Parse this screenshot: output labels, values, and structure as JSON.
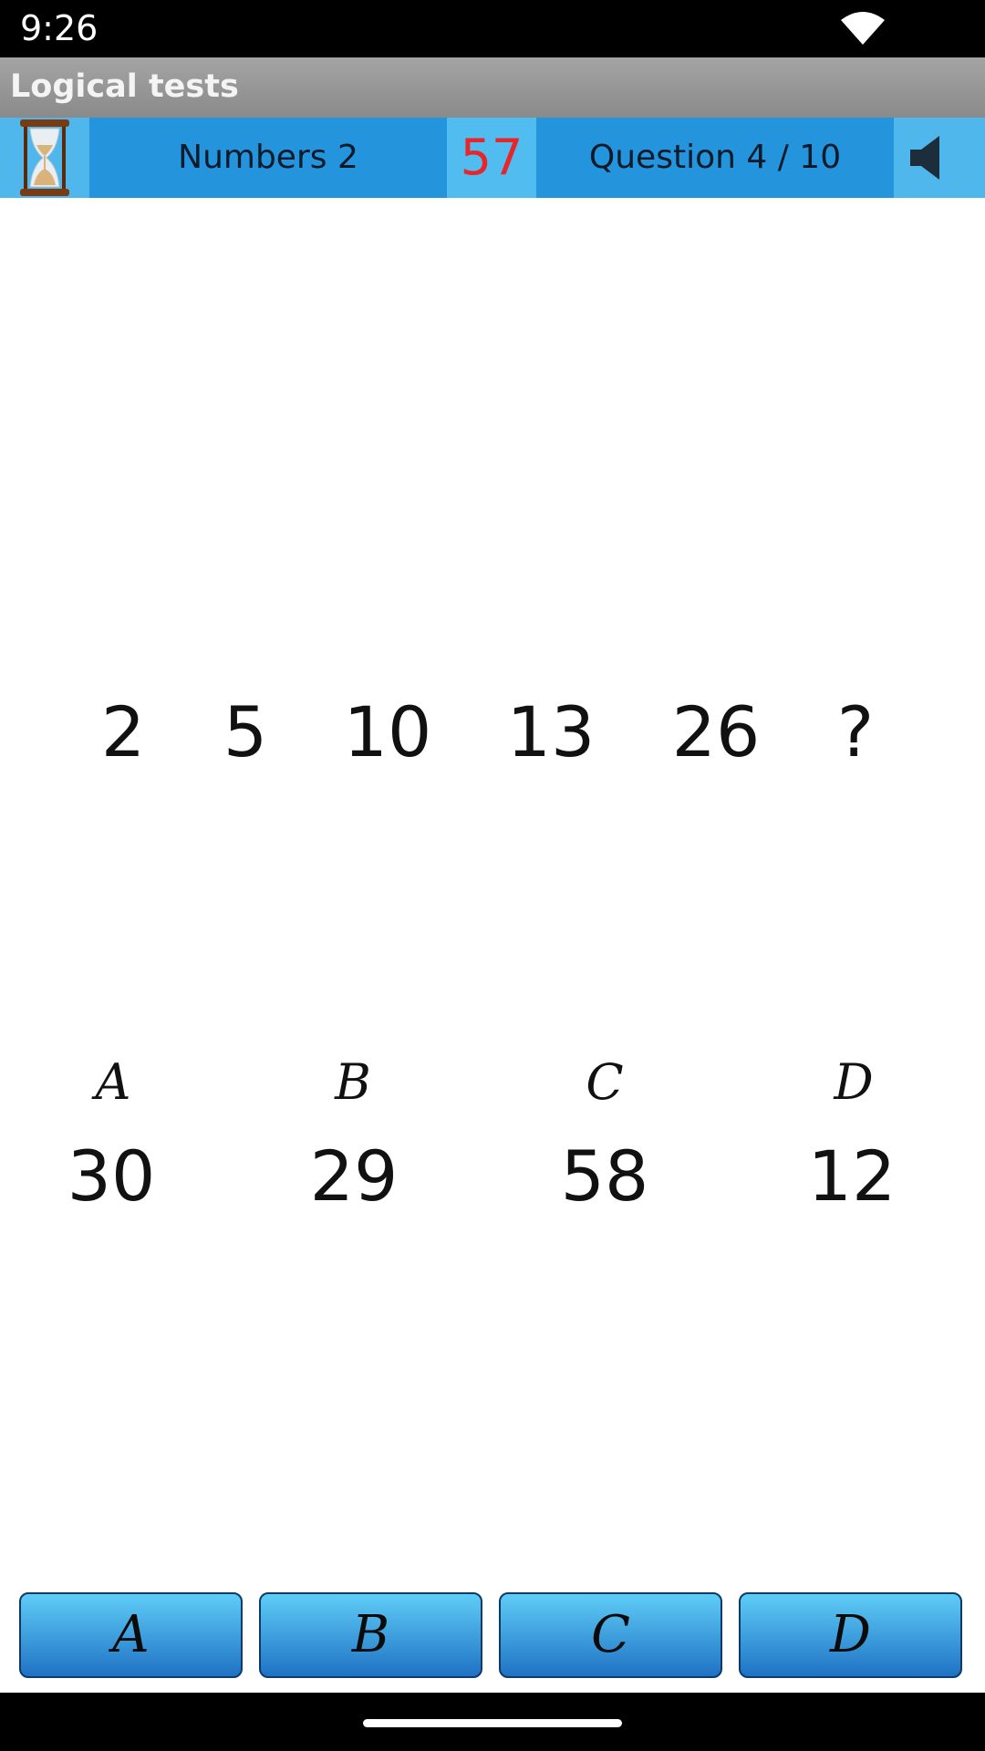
{
  "status_bar": {
    "time": "9:26"
  },
  "app": {
    "title": "Logical tests"
  },
  "info_bar": {
    "level": "Numbers 2",
    "timer": "57",
    "question": "Question 4 / 10"
  },
  "puzzle": {
    "sequence": [
      "2",
      "5",
      "10",
      "13",
      "26",
      "?"
    ]
  },
  "options": [
    {
      "letter": "A",
      "value": "30"
    },
    {
      "letter": "B",
      "value": "29"
    },
    {
      "letter": "C",
      "value": "58"
    },
    {
      "letter": "D",
      "value": "12"
    }
  ],
  "answer_buttons": [
    "A",
    "B",
    "C",
    "D"
  ],
  "colors": {
    "accent": "#2494dc",
    "timer": "#e8262a",
    "button_top": "#5fcdf7",
    "button_bottom": "#1f72c4"
  }
}
